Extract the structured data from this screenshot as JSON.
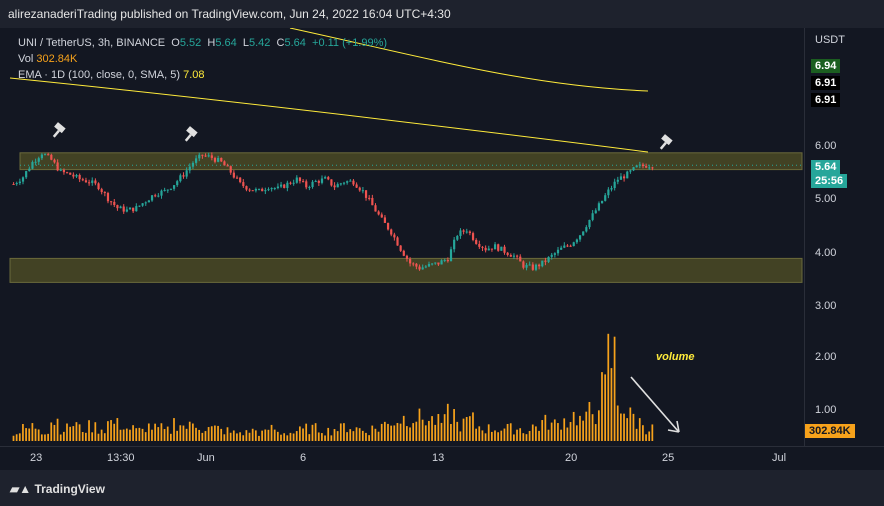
{
  "header": {
    "published_line": "alirezanaderiTrading published on TradingView.com, Jun 24, 2022 16:04 UTC+4:30"
  },
  "legend": {
    "symbol_line": "UNI / TetherUS, 3h, BINANCE",
    "o_label": "O",
    "o_value": "5.52",
    "h_label": "H",
    "h_value": "5.64",
    "l_label": "L",
    "l_value": "5.42",
    "c_label": "C",
    "c_value": "5.64",
    "change": "+0.11 (+1.99%)",
    "vol_label": "Vol",
    "vol_value": "302.84K",
    "ema_label": "EMA · 1D (100, close, 0, SMA, 5)",
    "ema_value": "7.08"
  },
  "price_axis": {
    "unit": "USDT",
    "ticks": [
      "6.00",
      "5.00",
      "4.00",
      "3.00",
      "2.00",
      "1.00"
    ],
    "tags": [
      {
        "text": "6.94",
        "bg": "#1b5e20",
        "fg": "#ffffff"
      },
      {
        "text": "6.91",
        "bg": "#000000",
        "fg": "#ffffff"
      },
      {
        "text": "6.91",
        "bg": "#000000",
        "fg": "#ffffff"
      },
      {
        "text": "5.64",
        "bg": "#26a69a",
        "fg": "#ffffff"
      },
      {
        "text": "25:56",
        "bg": "#26a69a",
        "fg": "#ffffff"
      },
      {
        "text": "302.84K",
        "bg": "#f7a21b",
        "fg": "#131722"
      }
    ]
  },
  "time_axis": {
    "ticks": [
      "23",
      "13:30",
      "Jun",
      "6",
      "13",
      "20",
      "25",
      "Jul"
    ]
  },
  "annotations": {
    "volume_label": "volume"
  },
  "footer": {
    "brand": "TradingView"
  },
  "colors": {
    "up": "#26a69a",
    "down": "#ef5350",
    "volume": "#f7a21b",
    "ema": "#ffeb3b",
    "zone": "#4b4a25",
    "arrow": "#e0e0e0"
  },
  "chart_data": {
    "type": "candlestick",
    "symbol": "UNI / TetherUS",
    "interval": "3h",
    "ylim": [
      3.0,
      6.3
    ],
    "current_price": 5.64,
    "support_zone": [
      3.2,
      3.7
    ],
    "resistance_zone": [
      5.55,
      5.9
    ],
    "price_path_close": [
      5.25,
      5.4,
      5.7,
      5.9,
      5.75,
      5.5,
      5.45,
      5.35,
      5.3,
      5.2,
      4.95,
      4.75,
      4.7,
      4.75,
      4.9,
      5.05,
      5.1,
      5.25,
      5.45,
      5.7,
      5.85,
      5.8,
      5.7,
      5.5,
      5.25,
      5.15,
      5.1,
      5.2,
      5.15,
      5.25,
      5.35,
      5.2,
      5.3,
      5.35,
      5.2,
      5.3,
      5.3,
      5.1,
      4.8,
      4.5,
      4.25,
      3.9,
      3.6,
      3.5,
      3.55,
      3.6,
      3.7,
      4.2,
      4.3,
      4.05,
      3.9,
      3.95,
      3.85,
      3.75,
      3.55,
      3.5,
      3.6,
      3.75,
      3.9,
      4.0,
      4.2,
      4.5,
      4.8,
      5.1,
      5.35,
      5.45,
      5.6,
      5.64
    ],
    "volume_path": [
      0.2,
      0.3,
      0.35,
      0.25,
      0.5,
      0.3,
      0.4,
      0.3,
      0.35,
      0.3,
      0.45,
      0.4,
      0.3,
      0.25,
      0.35,
      0.3,
      0.25,
      0.45,
      0.35,
      0.4,
      0.3,
      0.3,
      0.25,
      0.2,
      0.2,
      0.25,
      0.2,
      0.3,
      0.2,
      0.2,
      0.25,
      0.3,
      0.3,
      0.25,
      0.3,
      0.35,
      0.3,
      0.25,
      0.3,
      0.4,
      0.5,
      0.55,
      0.6,
      0.55,
      0.5,
      0.45,
      0.65,
      0.4,
      0.5,
      0.35,
      0.3,
      0.3,
      0.3,
      0.3,
      0.25,
      0.35,
      0.45,
      0.4,
      0.5,
      0.6,
      0.5,
      0.7,
      1.2,
      2.0,
      0.9,
      0.6,
      0.45,
      0.3
    ]
  }
}
